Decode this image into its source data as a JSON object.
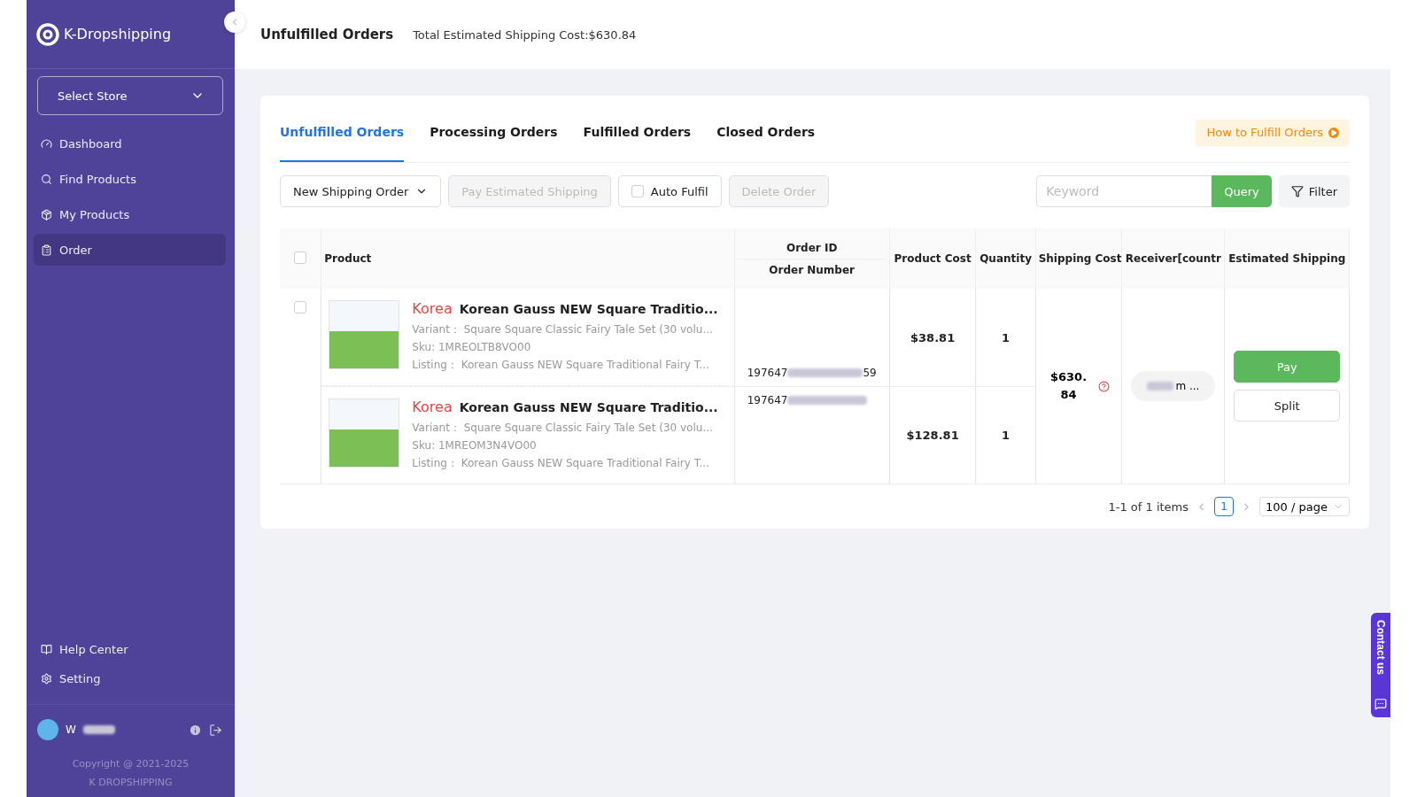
{
  "sidebar": {
    "logo": "K-Dropshipping",
    "store_select": {
      "placeholder": "Select Store"
    },
    "nav": [
      {
        "label": "Dashboard",
        "selected": false
      },
      {
        "label": "Find Products",
        "selected": false
      },
      {
        "label": "My Products",
        "selected": false
      },
      {
        "label": "Order",
        "selected": true
      }
    ],
    "bottom_nav": [
      {
        "label": "Help Center"
      },
      {
        "label": "Setting"
      }
    ],
    "user": {
      "name": "W"
    },
    "copyright": [
      "Copyright @ 2021-2025",
      "K DROPSHIPPING"
    ]
  },
  "header": {
    "title": "Unfulfilled Orders",
    "summary": "Total Estimated Shipping Cost:$630.84"
  },
  "tabs": [
    {
      "label": "Unfulfilled Orders",
      "selected": true
    },
    {
      "label": "Processing Orders",
      "selected": false
    },
    {
      "label": "Fulfilled Orders",
      "selected": false
    },
    {
      "label": "Closed Orders",
      "selected": false
    }
  ],
  "guide_button": "How to Fulfill Orders",
  "toolbar": {
    "new_order": "New Shipping Order",
    "pay_estimated": {
      "label": "Pay Estimated Shipping",
      "disabled": true
    },
    "auto_fulfil": {
      "label": "Auto Fulfil",
      "checked": false
    },
    "delete": {
      "label": "Delete Order",
      "disabled": true
    }
  },
  "search": {
    "placeholder": "Keyword",
    "button": "Query",
    "filter": "Filter"
  },
  "table": {
    "columns": {
      "product": "Product",
      "order_id": "Order ID",
      "order_number": "Order Number",
      "product_cost": "Product Cost",
      "quantity": "Quantity",
      "shipping_cost": "Shipping Cost",
      "receiver": "Receiver[countr",
      "estimated_shipping": "Estimated Shipping"
    },
    "header_checked": false,
    "order": {
      "checked": false,
      "items": [
        {
          "country": "Korea",
          "title": "Korean Gauss NEW Square Traditio...",
          "variant_label": "Variant：",
          "variant": "Square Square Classic Fairy Tale Set (30 volu...",
          "sku": "Sku: 1MREOLTB8VO00",
          "listing_label": "Listing：",
          "listing": "Korean Gauss NEW Square Traditional Fairy T...",
          "order_number_start": "197647",
          "order_number_end": "59",
          "product_cost": "$38.81",
          "quantity": "1"
        },
        {
          "country": "Korea",
          "title": "Korean Gauss NEW Square Traditio...",
          "variant_label": "Variant：",
          "variant": "Square Square Classic Fairy Tale Set (30 volu...",
          "sku": "Sku: 1MREOM3N4VO00",
          "listing_label": "Listing：",
          "listing": "Korean Gauss NEW Square Traditional Fairy T...",
          "order_number_start": "197647",
          "product_cost": "$128.81",
          "quantity": "1"
        }
      ],
      "shipping_cost": "$630.84",
      "receiver": "m ...",
      "actions": [
        "Pay",
        "Split"
      ]
    }
  },
  "pagination": {
    "range": "1-1 of 1 items",
    "pages": [
      {
        "label": "1",
        "selected": true
      }
    ],
    "page_size": "100 / page"
  },
  "contact": "Contact us"
}
